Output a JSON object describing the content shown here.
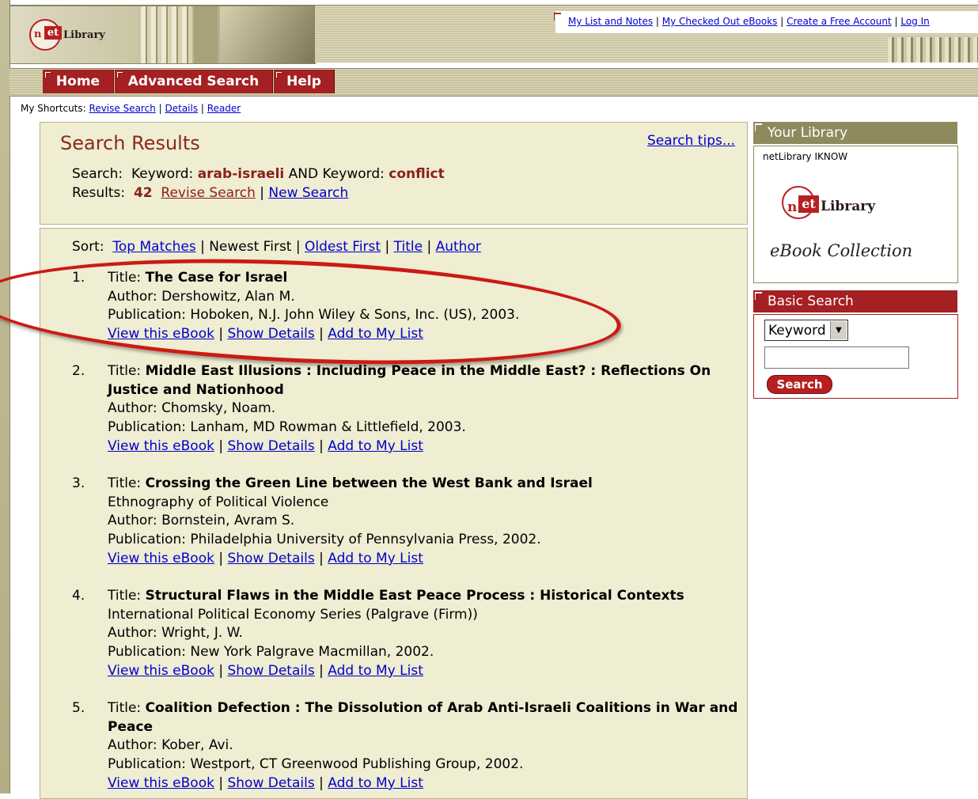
{
  "brand": {
    "logo_n": "n",
    "logo_et": "et",
    "logo_word": "Library"
  },
  "top_links": [
    "My List and Notes",
    "My Checked Out eBooks",
    "Create a Free Account",
    "Log In"
  ],
  "nav": {
    "items": [
      "Home",
      "Advanced Search",
      "Help"
    ]
  },
  "shortcuts": {
    "label": "My Shortcuts:",
    "links": [
      "Revise Search",
      "Details",
      "Reader"
    ]
  },
  "search_panel": {
    "title": "Search Results",
    "tips": "Search tips...",
    "search_label": "Search:",
    "kw_label_1": "Keyword:",
    "kw_value_1": "arab-israeli",
    "conj": "AND",
    "kw_label_2": "Keyword:",
    "kw_value_2": "conflict",
    "results_label": "Results:",
    "results_count": "42",
    "revise": "Revise Search",
    "new_search": "New Search"
  },
  "sort": {
    "label": "Sort:",
    "options": [
      "Top Matches",
      "Newest First",
      "Oldest First",
      "Title",
      "Author"
    ]
  },
  "result_actions": [
    "View this eBook",
    "Show Details",
    "Add to My List"
  ],
  "results": [
    {
      "num": "1.",
      "title_label": "Title:",
      "title": "The Case for Israel",
      "title2": "",
      "series": "",
      "author": "Author: Dershowitz, Alan M.",
      "publication": "Publication: Hoboken, N.J. John Wiley & Sons, Inc. (US), 2003."
    },
    {
      "num": "2.",
      "title_label": "Title:",
      "title": "Middle East Illusions : Including Peace in the Middle East? : Reflections On",
      "title2": "Justice and Nationhood",
      "series": "",
      "author": "Author: Chomsky, Noam.",
      "publication": "Publication: Lanham, MD Rowman & Littlefield, 2003."
    },
    {
      "num": "3.",
      "title_label": "Title:",
      "title": "Crossing the Green Line between the West Bank and Israel",
      "title2": "",
      "series": "Ethnography of Political Violence",
      "author": "Author: Bornstein, Avram S.",
      "publication": "Publication: Philadelphia University of Pennsylvania Press, 2002."
    },
    {
      "num": "4.",
      "title_label": "Title:",
      "title": "Structural Flaws in the Middle East Peace Process : Historical Contexts",
      "title2": "",
      "series": "International Political Economy Series (Palgrave (Firm))",
      "author": "Author: Wright, J. W.",
      "publication": "Publication: New York Palgrave Macmillan, 2002."
    },
    {
      "num": "5.",
      "title_label": "Title:",
      "title": "Coalition Defection : The Dissolution of Arab Anti-Israeli Coalitions in War and",
      "title2": "Peace",
      "series": "",
      "author": "Author: Kober, Avi.",
      "publication": "Publication: Westport, CT Greenwood Publishing Group, 2002."
    }
  ],
  "sidebar": {
    "your_library": {
      "heading": "Your Library",
      "institution": "netLibrary IKNOW",
      "collection": "eBook Collection"
    },
    "basic_search": {
      "heading": "Basic Search",
      "select_value": "Keyword",
      "input_value": "",
      "button": "Search"
    }
  },
  "colors": {
    "accent_maroon": "#a52022",
    "panel_bg": "#efedd2",
    "header_olive": "#c7c19d",
    "annotation_red": "#cc1a14"
  }
}
